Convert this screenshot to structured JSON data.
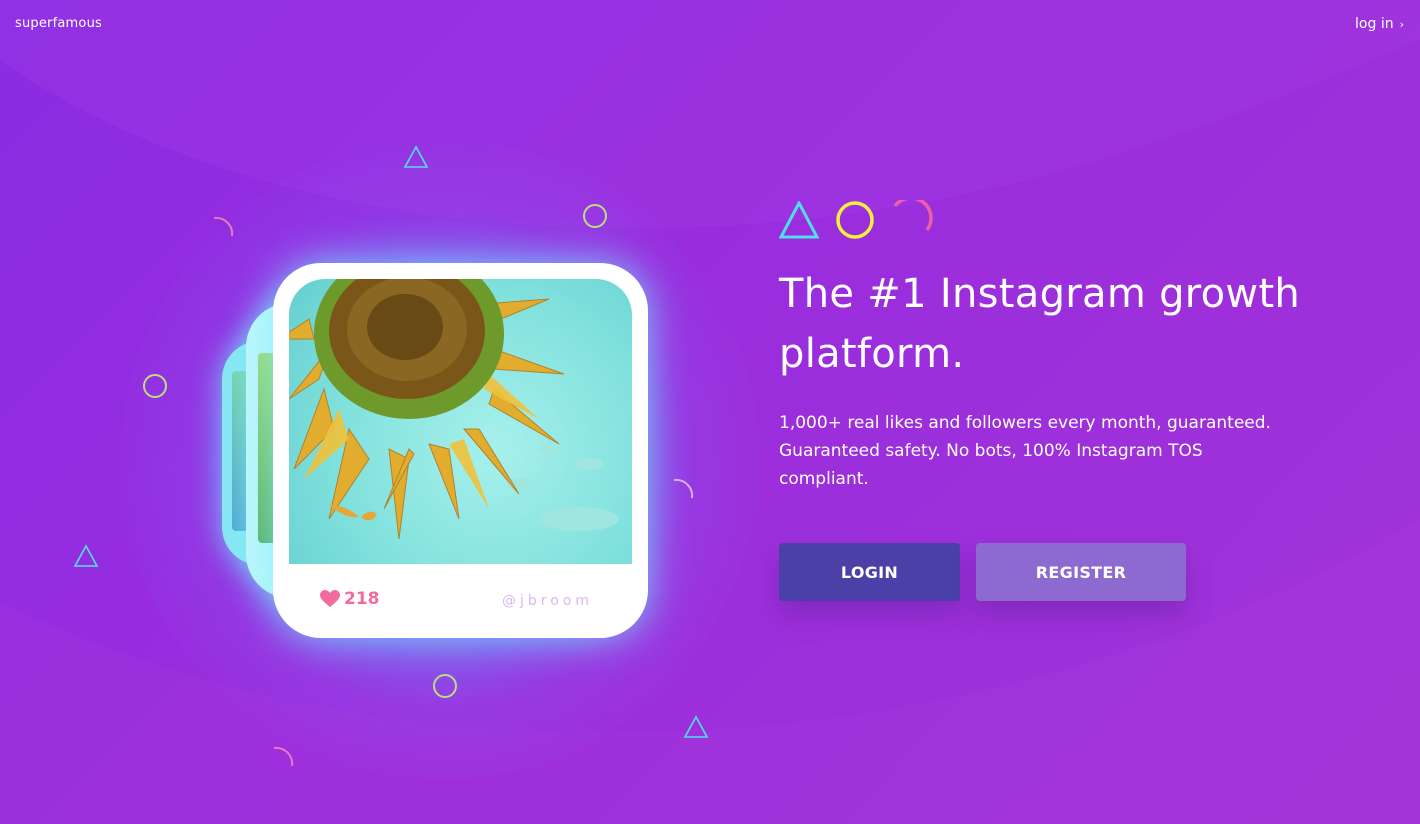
{
  "header": {
    "brand": "superfamous",
    "login_link": "log in",
    "login_chevron": "›"
  },
  "post_card": {
    "likes": "218",
    "handle": "@jbroom",
    "like_icon": "heart-icon",
    "photo": "sunflower-photo"
  },
  "hero": {
    "icons": [
      "triangle-icon",
      "circle-icon",
      "arc-icon"
    ],
    "title": "The #1 Instagram growth platform.",
    "subtitle": "1,000+ real likes and followers every month, guaranteed. Guaranteed safety. No bots, 100% Instagram TOS compliant.",
    "login_button": "LOGIN",
    "register_button": "REGISTER"
  },
  "colors": {
    "background": "#9a2ddd",
    "glow": "#5ac8ff",
    "likes": "#f26b9e",
    "login_button": "#4b3fa8",
    "register_button": "#8c6ad0",
    "accent_triangle": "#4fe0f0",
    "accent_circle": "#f5f03c",
    "accent_arc": "#f05fa0"
  }
}
